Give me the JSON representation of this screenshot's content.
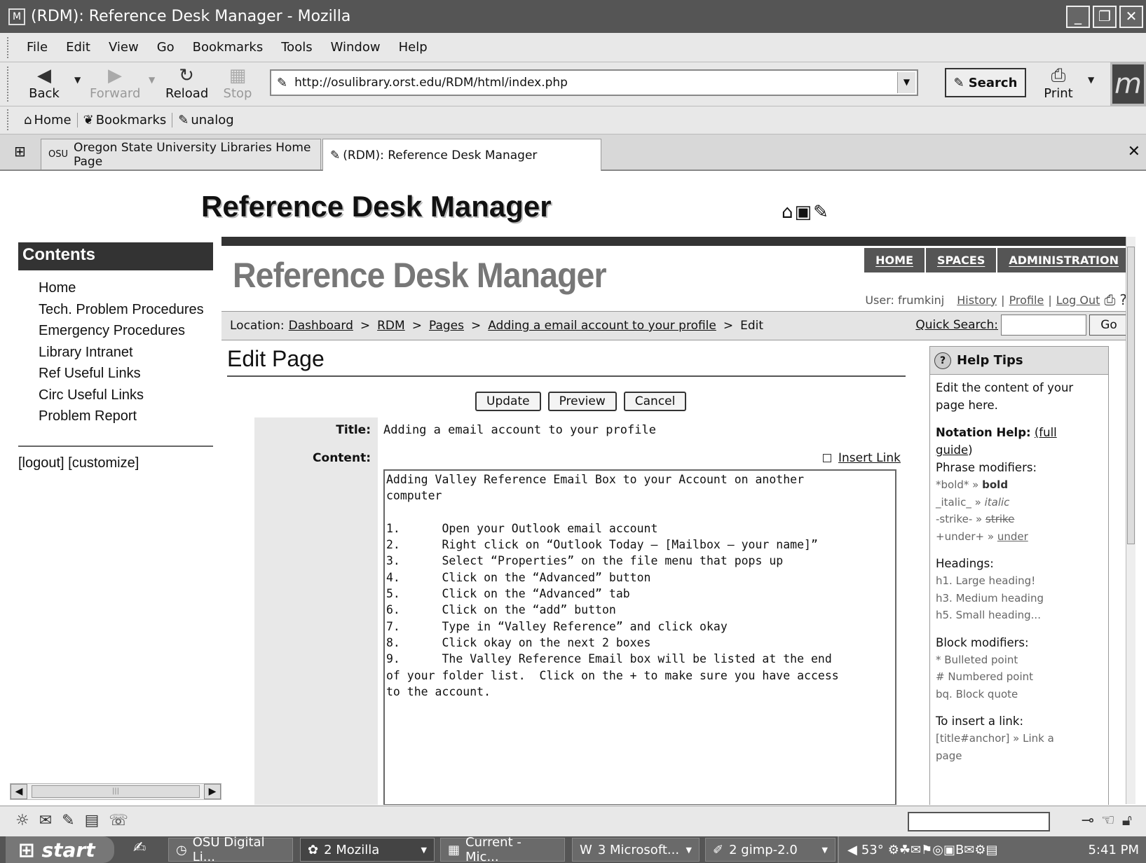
{
  "window": {
    "title": "(RDM): Reference Desk Manager - Mozilla",
    "app_icon": "mozilla-icon",
    "buttons": [
      "_",
      "❐",
      "✕"
    ]
  },
  "menu": [
    "File",
    "Edit",
    "View",
    "Go",
    "Bookmarks",
    "Tools",
    "Window",
    "Help"
  ],
  "navbar": {
    "back": "Back",
    "forward": "Forward",
    "reload": "Reload",
    "stop": "Stop",
    "url": "http://osulibrary.orst.edu/RDM/html/index.php",
    "search": "Search",
    "print": "Print"
  },
  "personal_toolbar": [
    "Home",
    "Bookmarks",
    "unalog"
  ],
  "tabs": [
    {
      "label": "Oregon State University Libraries Home Page",
      "favicon": "OSU",
      "active": false
    },
    {
      "label": "(RDM): Reference Desk Manager",
      "active": true
    }
  ],
  "page": {
    "outer_title": "Reference Desk Manager",
    "sidebar": {
      "heading": "Contents",
      "items": [
        "Home",
        "Tech. Problem Procedures",
        "Emergency Procedures",
        "Library Intranet",
        "Ref Useful Links",
        "Circ Useful Links",
        "Problem Report"
      ],
      "footer": "[logout] [customize]"
    },
    "confluence": {
      "nav_tabs": [
        "HOME",
        "SPACES",
        "ADMINISTRATION"
      ],
      "logo": "Reference Desk Manager",
      "user_label": "User: frumkinj",
      "user_links": [
        "History",
        "Profile",
        "Log Out"
      ],
      "location_label": "Location:",
      "breadcrumb": [
        "Dashboard",
        "RDM",
        "Pages",
        "Adding a email account to your profile"
      ],
      "breadcrumb_current": "Edit",
      "quick_search_label": "Quick Search:",
      "quick_search_go": "Go",
      "heading": "Edit Page",
      "buttons": [
        "Update",
        "Preview",
        "Cancel"
      ],
      "title_label": "Title:",
      "title_value": "Adding a email account to your profile",
      "content_label": "Content:",
      "insert_link": "Insert Link",
      "content_text": "Adding Valley Reference Email Box to your Account on another\ncomputer\n\n1.      Open your Outlook email account\n2.      Right click on “Outlook Today – [Mailbox – your name]”\n3.      Select “Properties” on the file menu that pops up\n4.      Click on the “Advanced” button\n5.      Click on the “Advanced” tab\n6.      Click on the “add” button\n7.      Type in “Valley Reference” and click okay\n8.      Click okay on the next 2 boxes\n9.      The Valley Reference Email box will be listed at the end\nof your folder list.  Click on the + to make sure you have access\nto the account."
    },
    "help": {
      "heading": "Help Tips",
      "intro": "Edit the content of your page here.",
      "notation_label": "Notation Help:",
      "notation_link_1": "(full",
      "notation_link_2": "guide",
      "notation_close": ")",
      "phrase_heading": "Phrase modifiers:",
      "phrase": [
        {
          "code": "*bold*",
          "result": "bold"
        },
        {
          "code": "_italic_",
          "result": "italic"
        },
        {
          "code": "-strike-",
          "result": "strike"
        },
        {
          "code": "+under+",
          "result": "under"
        }
      ],
      "arrow": "»",
      "headings_heading": "Headings:",
      "headings": [
        "h1. Large heading!",
        "h3. Medium heading",
        "h5. Small heading..."
      ],
      "block_heading": "Block modifiers:",
      "blocks": [
        "* Bulleted point",
        "# Numbered point",
        "bq. Block quote"
      ],
      "link_heading": "To insert a link:",
      "link_example": "[title#anchor] » Link a",
      "link_example_2": "page"
    }
  },
  "taskbar": {
    "start": "start",
    "tasks": [
      "OSU Digital Li...",
      "2 Mozilla",
      "Current - Mic...",
      "3 Microsoft...",
      "2 gimp-2.0"
    ],
    "temp": "53°",
    "clock": "5:41 PM"
  }
}
